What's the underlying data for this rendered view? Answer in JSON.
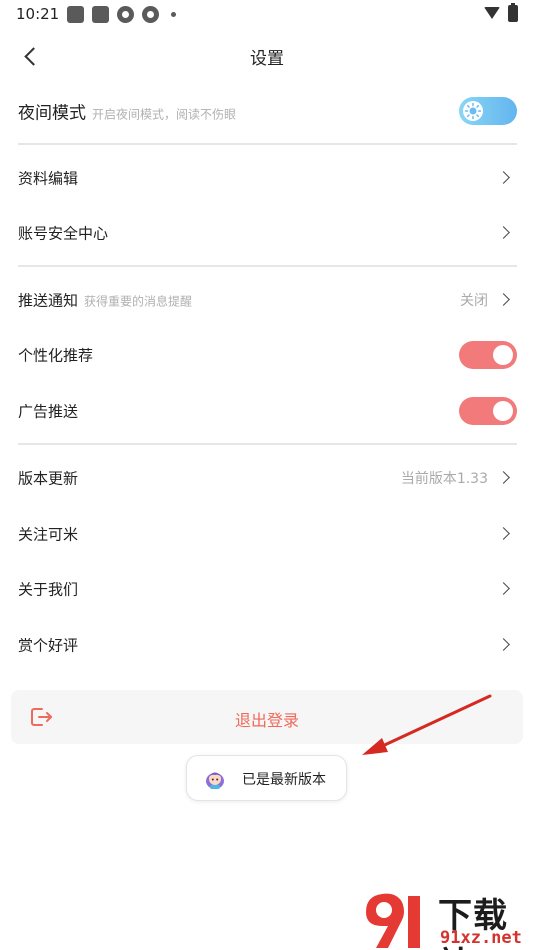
{
  "status_bar": {
    "time": "10:21",
    "notification_icons": [
      "app-square-icon",
      "app-square-icon",
      "shutter-icon",
      "shutter-icon"
    ],
    "wifi_icon": "wifi-icon",
    "battery_icon": "battery-charging-icon"
  },
  "header": {
    "back_icon": "chevron-left-icon",
    "title": "设置"
  },
  "night_mode": {
    "label": "夜间模式",
    "subtitle": "开启夜间模式，阅读不伤眼",
    "toggle_icon": "sun-icon",
    "colors": {
      "start": "#8ad6f5",
      "end": "#62b5ef"
    }
  },
  "account": {
    "profile_edit": "资料编辑",
    "security_center": "账号安全中心"
  },
  "notifications": {
    "push_label": "推送通知",
    "push_subtitle": "获得重要的消息提醒",
    "push_value": "关闭",
    "personalized_label": "个性化推荐",
    "personalized_on": true,
    "ads_label": "广告推送",
    "ads_on": true,
    "toggle_color": "#f27a7b"
  },
  "about": {
    "version_label": "版本更新",
    "version_value": "当前版本1.33",
    "follow_label": "关注可米",
    "about_us_label": "关于我们",
    "rate_label": "赏个好评"
  },
  "logout": {
    "icon": "logout-icon",
    "label": "退出登录",
    "color": "#ef6a5a"
  },
  "toast": {
    "icon": "mascot-icon",
    "text": "已是最新版本"
  },
  "watermark": {
    "text_top": "下载站",
    "text_bottom": "91xz.net"
  }
}
